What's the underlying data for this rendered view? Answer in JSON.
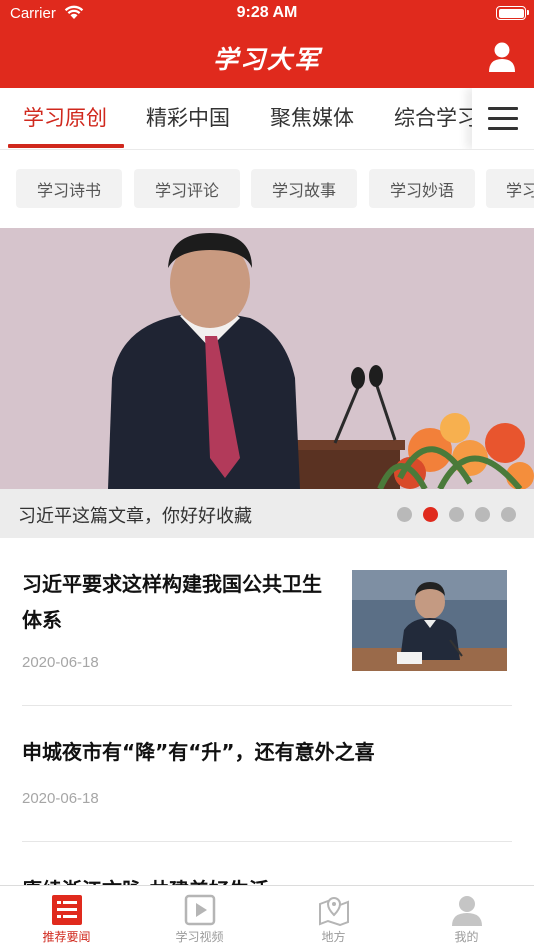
{
  "status_bar": {
    "carrier": "Carrier",
    "time": "9:28 AM"
  },
  "header": {
    "logo_text": "学习大军"
  },
  "tabs": [
    {
      "label": "学习原创",
      "active": true
    },
    {
      "label": "精彩中国",
      "active": false
    },
    {
      "label": "聚焦媒体",
      "active": false
    },
    {
      "label": "综合学习",
      "active": false
    }
  ],
  "subtags": [
    "学习诗书",
    "学习评论",
    "学习故事",
    "学习妙语",
    "学习"
  ],
  "banner": {
    "caption": "习近平这篇文章，你好好收藏",
    "slide_count": 5,
    "active_slide": 2
  },
  "articles": [
    {
      "title": "习近平要求这样构建我国公共卫生体系",
      "date": "2020-06-18",
      "has_thumbnail": true
    },
    {
      "title": "申城夜市有“降”有“升”，还有意外之喜",
      "date": "2020-06-18",
      "has_thumbnail": false
    },
    {
      "title": "赓续浙江文脉 共建美好生活",
      "date": "",
      "has_thumbnail": false
    }
  ],
  "bottom_nav": [
    {
      "label": "推荐要闻",
      "icon": "news-icon",
      "active": true
    },
    {
      "label": "学习视频",
      "icon": "video-icon",
      "active": false
    },
    {
      "label": "地方",
      "icon": "map-icon",
      "active": false
    },
    {
      "label": "我的",
      "icon": "profile-icon",
      "active": false
    }
  ],
  "colors": {
    "brand_red": "#e02a1d",
    "active_text": "#d0281d",
    "inactive_gray": "#9a9a9a"
  }
}
